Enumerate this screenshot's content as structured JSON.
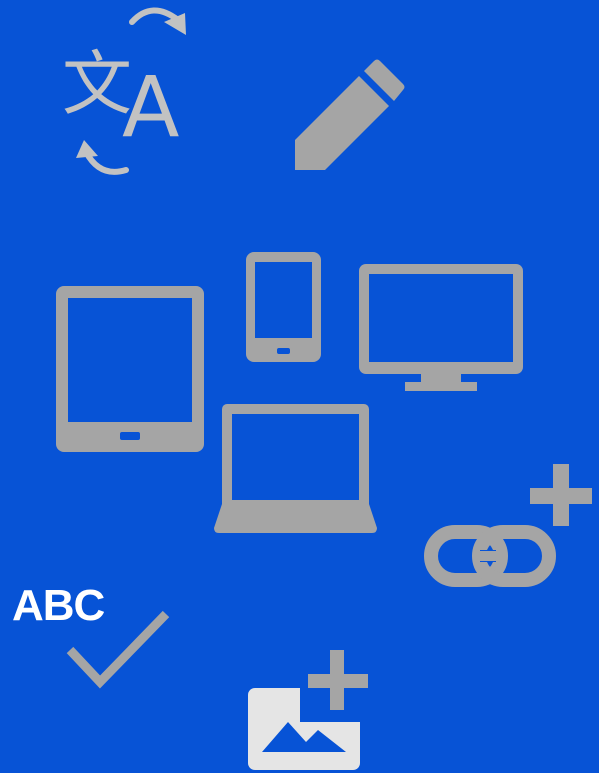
{
  "colors": {
    "background": "#0753d6",
    "icon_gray": "#a5a5a5",
    "icon_light": "#c2c2c2",
    "image_bg": "#e5e5e5",
    "text_white": "#ffffff"
  },
  "icons": [
    {
      "name": "translate-icon",
      "glyphs": [
        "文",
        "A"
      ]
    },
    {
      "name": "pencil-icon"
    },
    {
      "name": "tablet-icon"
    },
    {
      "name": "smartphone-icon"
    },
    {
      "name": "monitor-icon"
    },
    {
      "name": "laptop-icon"
    },
    {
      "name": "add-link-icon"
    },
    {
      "name": "spellcheck-icon",
      "text": "ABC"
    },
    {
      "name": "add-image-icon"
    }
  ]
}
